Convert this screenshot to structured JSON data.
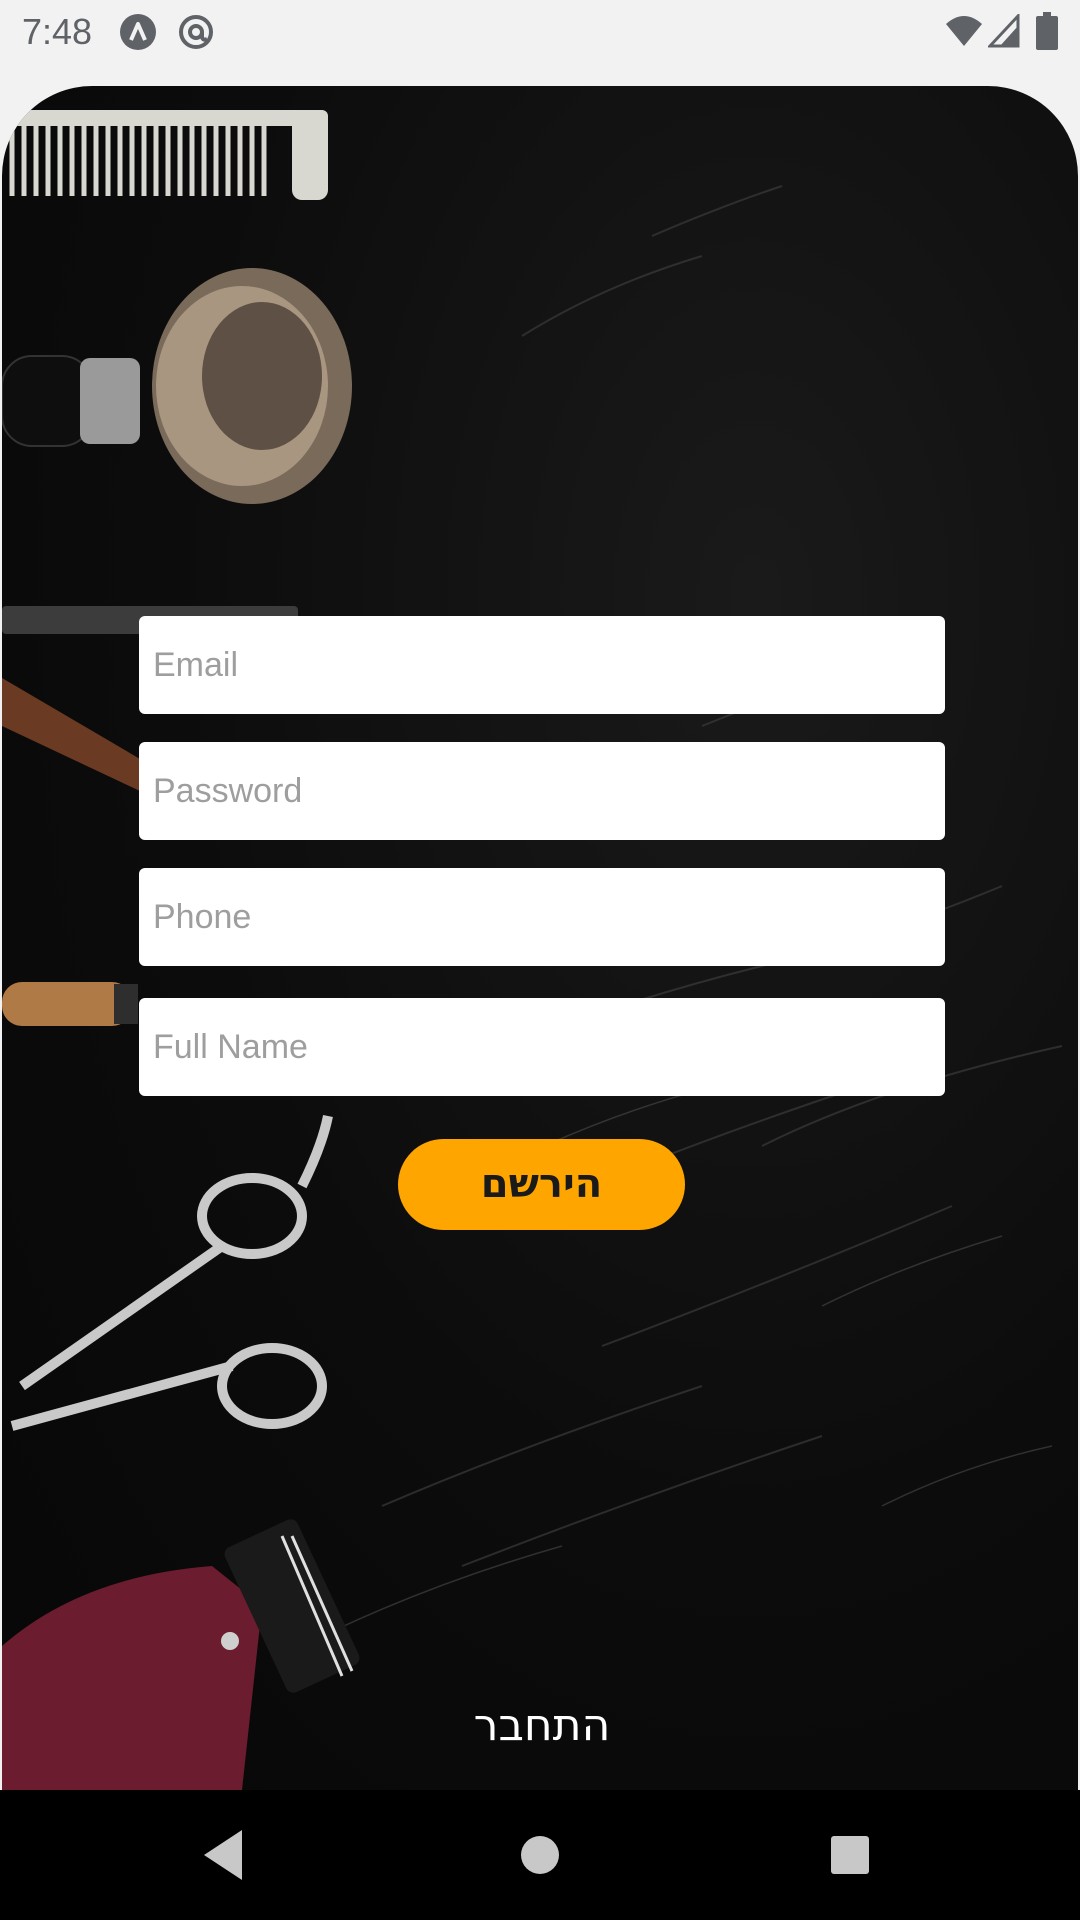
{
  "status_bar": {
    "time": "7:48",
    "icons": [
      "app-notification-a-icon",
      "app-notification-at-icon",
      "wifi-icon",
      "cellular-signal-icon",
      "battery-icon"
    ]
  },
  "form": {
    "email_placeholder": "Email",
    "password_placeholder": "Password",
    "phone_placeholder": "Phone",
    "full_name_placeholder": "Full Name",
    "register_label": "הירשם",
    "login_label": "התחבר"
  },
  "colors": {
    "accent": "#ffa500",
    "background": "#0c0c0c",
    "field_background": "#ffffff",
    "placeholder": "#9e9e9e"
  },
  "nav_bar": {
    "icons": [
      "back-icon",
      "home-icon",
      "recents-icon"
    ]
  }
}
